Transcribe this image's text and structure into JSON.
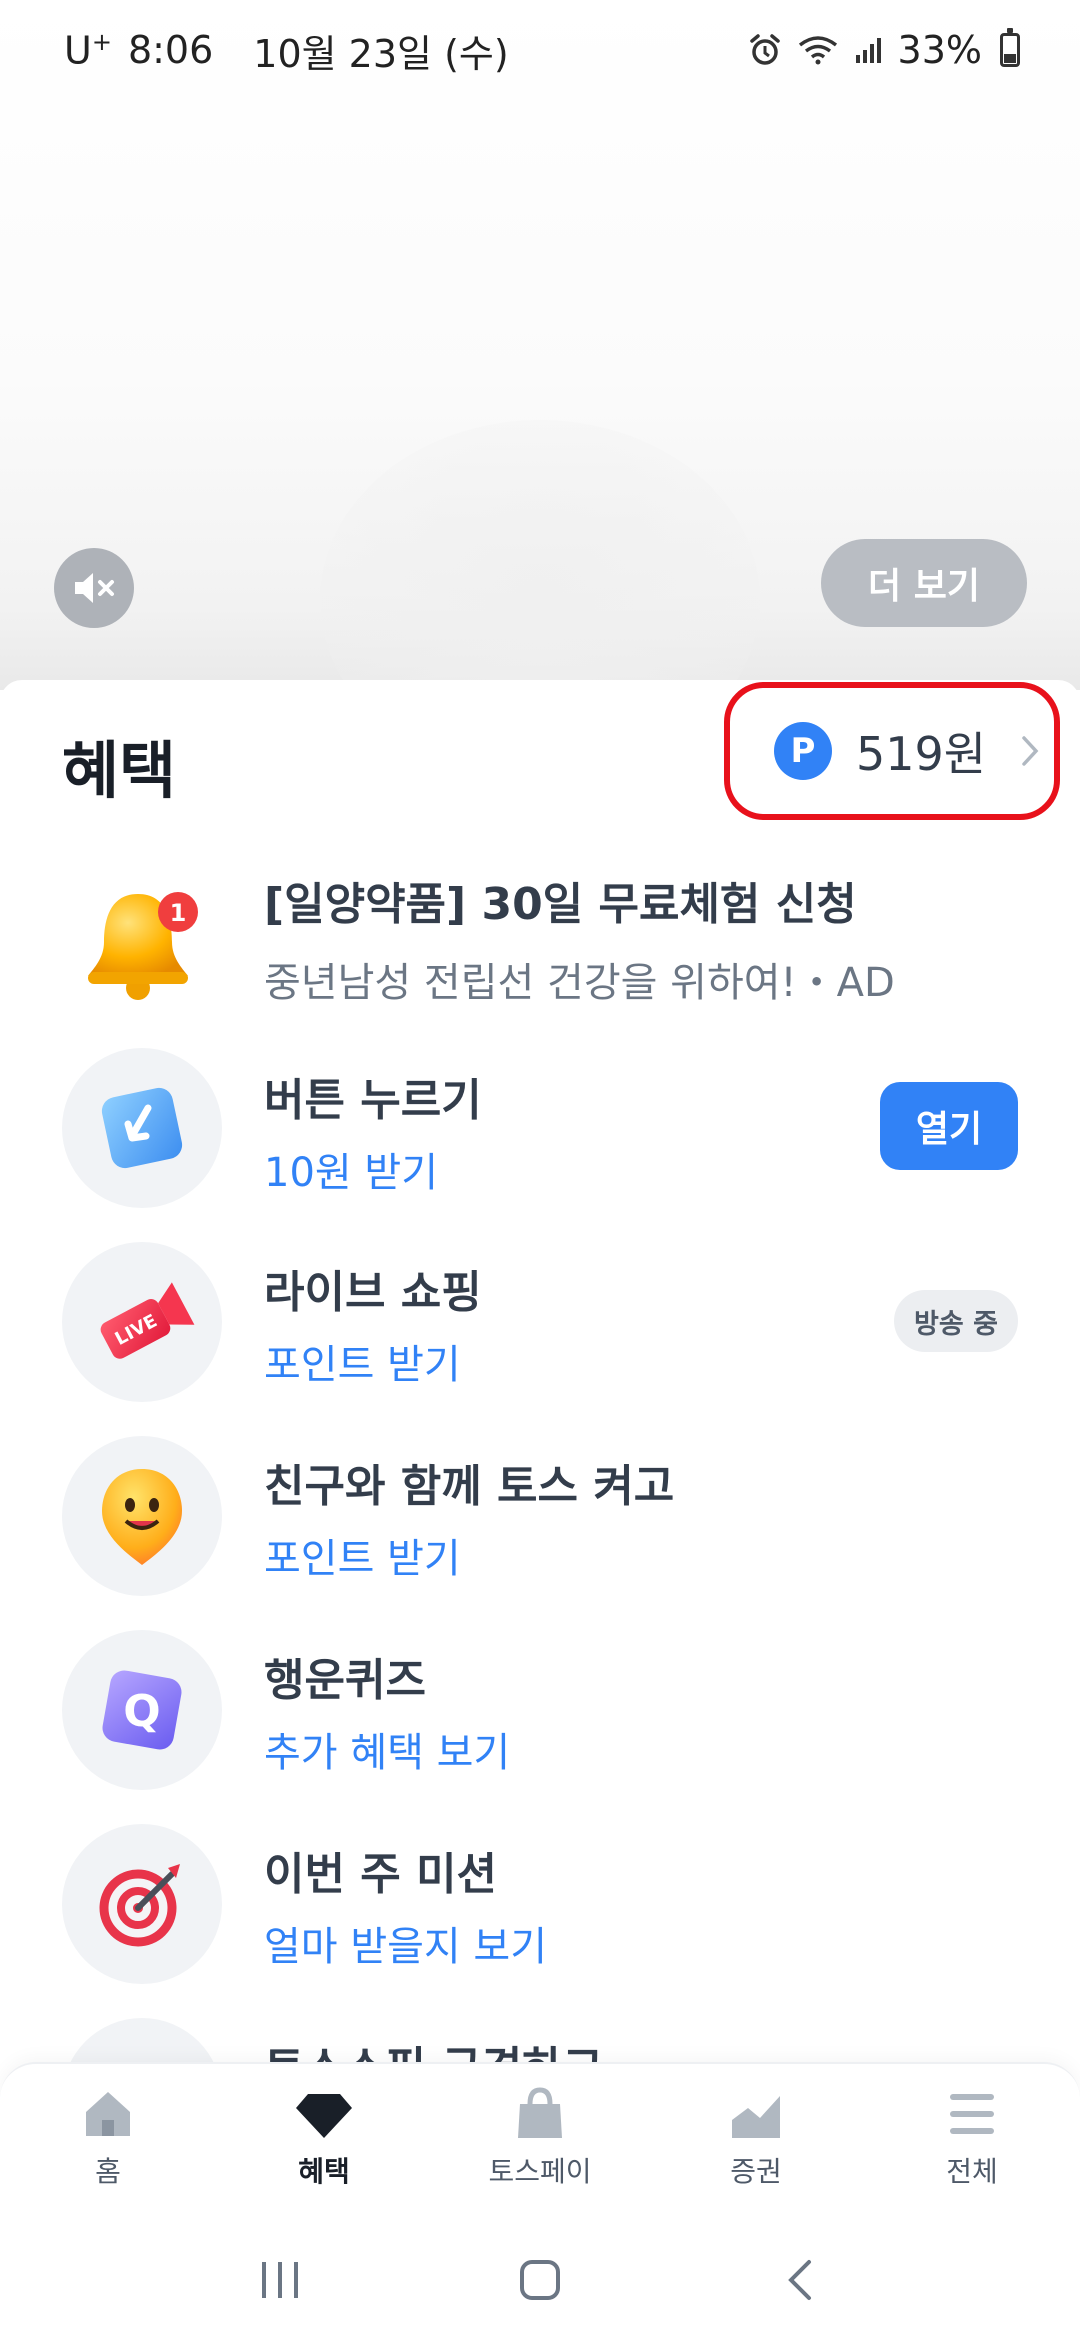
{
  "status_bar": {
    "carrier": "U",
    "carrier_plus": "+",
    "time": "8:06",
    "date": "10월 23일 (수)",
    "battery": "33%"
  },
  "hero": {
    "more_label": "더 보기"
  },
  "header": {
    "title": "혜택",
    "points_badge": "P",
    "points_amount": "519원"
  },
  "items": [
    {
      "title": "[일양약품] 30일 무료체험 신청",
      "subtitle": "중년남성 전립선 건강을 위하여!・AD",
      "notification_count": "1",
      "icon": "bell-icon"
    },
    {
      "title": "버튼 누르기",
      "subtitle": "10원 받기",
      "action": "열기",
      "icon": "press-button-icon"
    },
    {
      "title": "라이브 쇼핑",
      "subtitle": "포인트 받기",
      "badge": "방송 중",
      "icon": "live-shopping-icon",
      "icon_text": "LIVE"
    },
    {
      "title": "친구와 함께 토스 켜고",
      "subtitle": "포인트 받기",
      "icon": "smiley-icon"
    },
    {
      "title": "행운퀴즈",
      "subtitle": "추가 혜택 보기",
      "icon": "quiz-icon",
      "icon_text": "Q"
    },
    {
      "title": "이번 주 미션",
      "subtitle": "얼마 받을지 보기",
      "icon": "target-icon"
    },
    {
      "title": "토스쇼핑 구경하고",
      "icon": "shopping-icon"
    }
  ],
  "bottom_nav": [
    {
      "label": "홈",
      "icon": "home-icon"
    },
    {
      "label": "혜택",
      "icon": "gem-icon",
      "active": true
    },
    {
      "label": "토스페이",
      "icon": "shopping-bag-icon"
    },
    {
      "label": "증권",
      "icon": "chart-icon"
    },
    {
      "label": "전체",
      "icon": "menu-icon"
    }
  ],
  "colors": {
    "accent": "#3182f6",
    "highlight_border": "#e8111b",
    "text_primary": "#191f28",
    "text_secondary": "#6b7684"
  }
}
